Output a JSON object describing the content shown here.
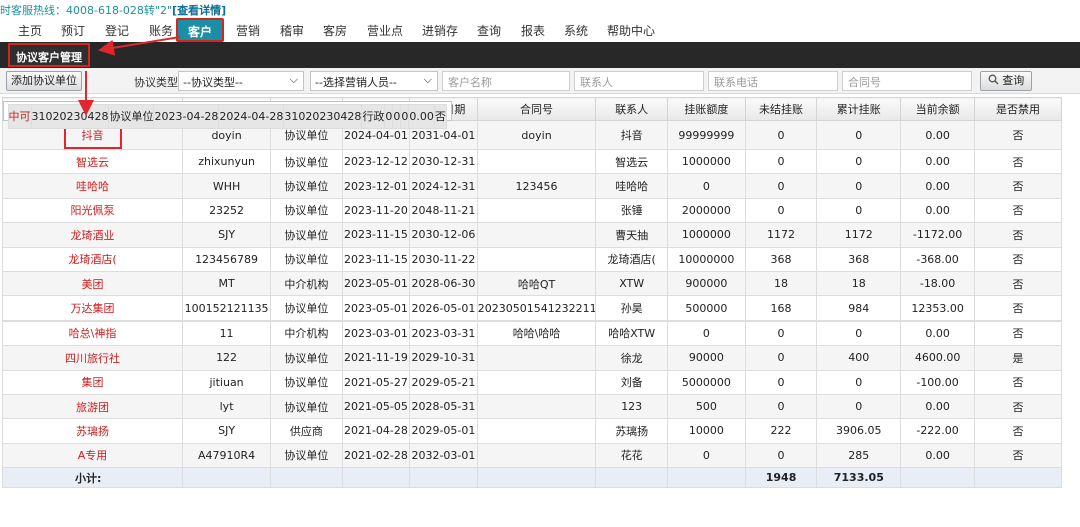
{
  "hotline": {
    "text": "时客服热线：4008-618-028转\"2\"",
    "detail": "[查看详情]"
  },
  "nav": {
    "items": [
      "主页",
      "预订",
      "登记",
      "账务",
      "客户",
      "营销",
      "稽审",
      "客房",
      "营业点",
      "进销存",
      "查询",
      "报表",
      "系统",
      "帮助中心"
    ],
    "active": "客户"
  },
  "subtab": "协议客户管理",
  "filters": {
    "add_button": "添加协议单位",
    "type_label": "协议类型",
    "type_value": "--协议类型--",
    "sales_value": "--选择营销人员--",
    "name_placeholder": "客户名称",
    "contact_placeholder": "联系人",
    "phone_placeholder": "联系电话",
    "contract_placeholder": "合同号",
    "search_button": "查询",
    "search_icon": "magnifier-icon"
  },
  "table": {
    "headers": [
      "客户名称",
      "客户代码",
      "协议类型",
      "生效日期",
      "失效日期",
      "合同号",
      "联系人",
      "挂账额度",
      "未结挂账",
      "累计挂账",
      "当前余额",
      "是否禁用"
    ],
    "rows": [
      [
        "抖音",
        "doyin",
        "协议单位",
        "2024-04-01",
        "2031-04-01",
        "doyin",
        "抖音",
        "99999999",
        "0",
        "0",
        "0.00",
        "否"
      ],
      [
        "智选云",
        "zhixunyun",
        "协议单位",
        "2023-12-12",
        "2030-12-31",
        "",
        "智选云",
        "1000000",
        "0",
        "0",
        "0.00",
        "否"
      ],
      [
        "哇哈哈",
        "WHH",
        "协议单位",
        "2023-12-01",
        "2024-12-31",
        "123456",
        "哇哈哈",
        "0",
        "0",
        "0",
        "0.00",
        "否"
      ],
      [
        "阳光佩泵",
        "23252",
        "协议单位",
        "2023-11-20",
        "2048-11-21",
        "",
        "张锤",
        "2000000",
        "0",
        "0",
        "0.00",
        "否"
      ],
      [
        "龙琦酒业",
        "SJY",
        "协议单位",
        "2023-11-15",
        "2030-12-06",
        "",
        "曹天抽",
        "1000000",
        "1172",
        "1172",
        "-1172.00",
        "否"
      ],
      [
        "龙琦酒店(",
        "123456789",
        "协议单位",
        "2023-11-15",
        "2030-11-22",
        "",
        "龙琦酒店(",
        "10000000",
        "368",
        "368",
        "-368.00",
        "否"
      ],
      [
        "美团",
        "MT",
        "中介机构",
        "2023-05-01",
        "2028-06-30",
        "哈哈QT",
        "XTW",
        "900000",
        "18",
        "18",
        "-18.00",
        "否"
      ],
      [
        "万达集团",
        "100152121135",
        "协议单位",
        "2023-05-01",
        "2026-05-01",
        "20230501541232211...",
        "孙昊",
        "500000",
        "168",
        "984",
        "12353.00",
        "否"
      ],
      [
        "中可",
        "31020230428",
        "协议单位",
        "2023-04-28",
        "2024-04-28",
        "31020230428",
        "行政",
        "0",
        "0",
        "0",
        "0.00",
        "否"
      ],
      [
        "哈总\\神指",
        "11",
        "中介机构",
        "2023-03-01",
        "2023-03-31",
        "哈哈\\哈哈",
        "哈哈XTW",
        "0",
        "0",
        "0",
        "0.00",
        "否"
      ],
      [
        "四川旅行社",
        "122",
        "协议单位",
        "2021-11-19",
        "2029-10-31",
        "",
        "徐龙",
        "90000",
        "0",
        "400",
        "4600.00",
        "是"
      ],
      [
        "集团",
        "jitiuan",
        "协议单位",
        "2021-05-27",
        "2029-05-21",
        "",
        "刘备",
        "5000000",
        "0",
        "0",
        "-100.00",
        "否"
      ],
      [
        "旅游团",
        "lyt",
        "协议单位",
        "2021-05-05",
        "2028-05-31",
        "",
        "123",
        "500",
        "0",
        "0",
        "0.00",
        "否"
      ],
      [
        "苏璃扬",
        "SJY",
        "供应商",
        "2021-04-28",
        "2029-05-01",
        "",
        "苏璃扬",
        "10000",
        "222",
        "3906.05",
        "-222.00",
        "否"
      ],
      [
        "A专用",
        "A47910R4",
        "协议单位",
        "2021-02-28",
        "2032-03-01",
        "",
        "花花",
        "0",
        "0",
        "285",
        "0.00",
        "否"
      ]
    ],
    "total": {
      "label": "小计:",
      "unsettled": "1948",
      "cumulative": "7133.05"
    }
  },
  "colors": {
    "active_tab": "#1a8fa6",
    "annotation": "#e0262e",
    "name_link": "#cc1d1d",
    "subbar": "#282828"
  }
}
